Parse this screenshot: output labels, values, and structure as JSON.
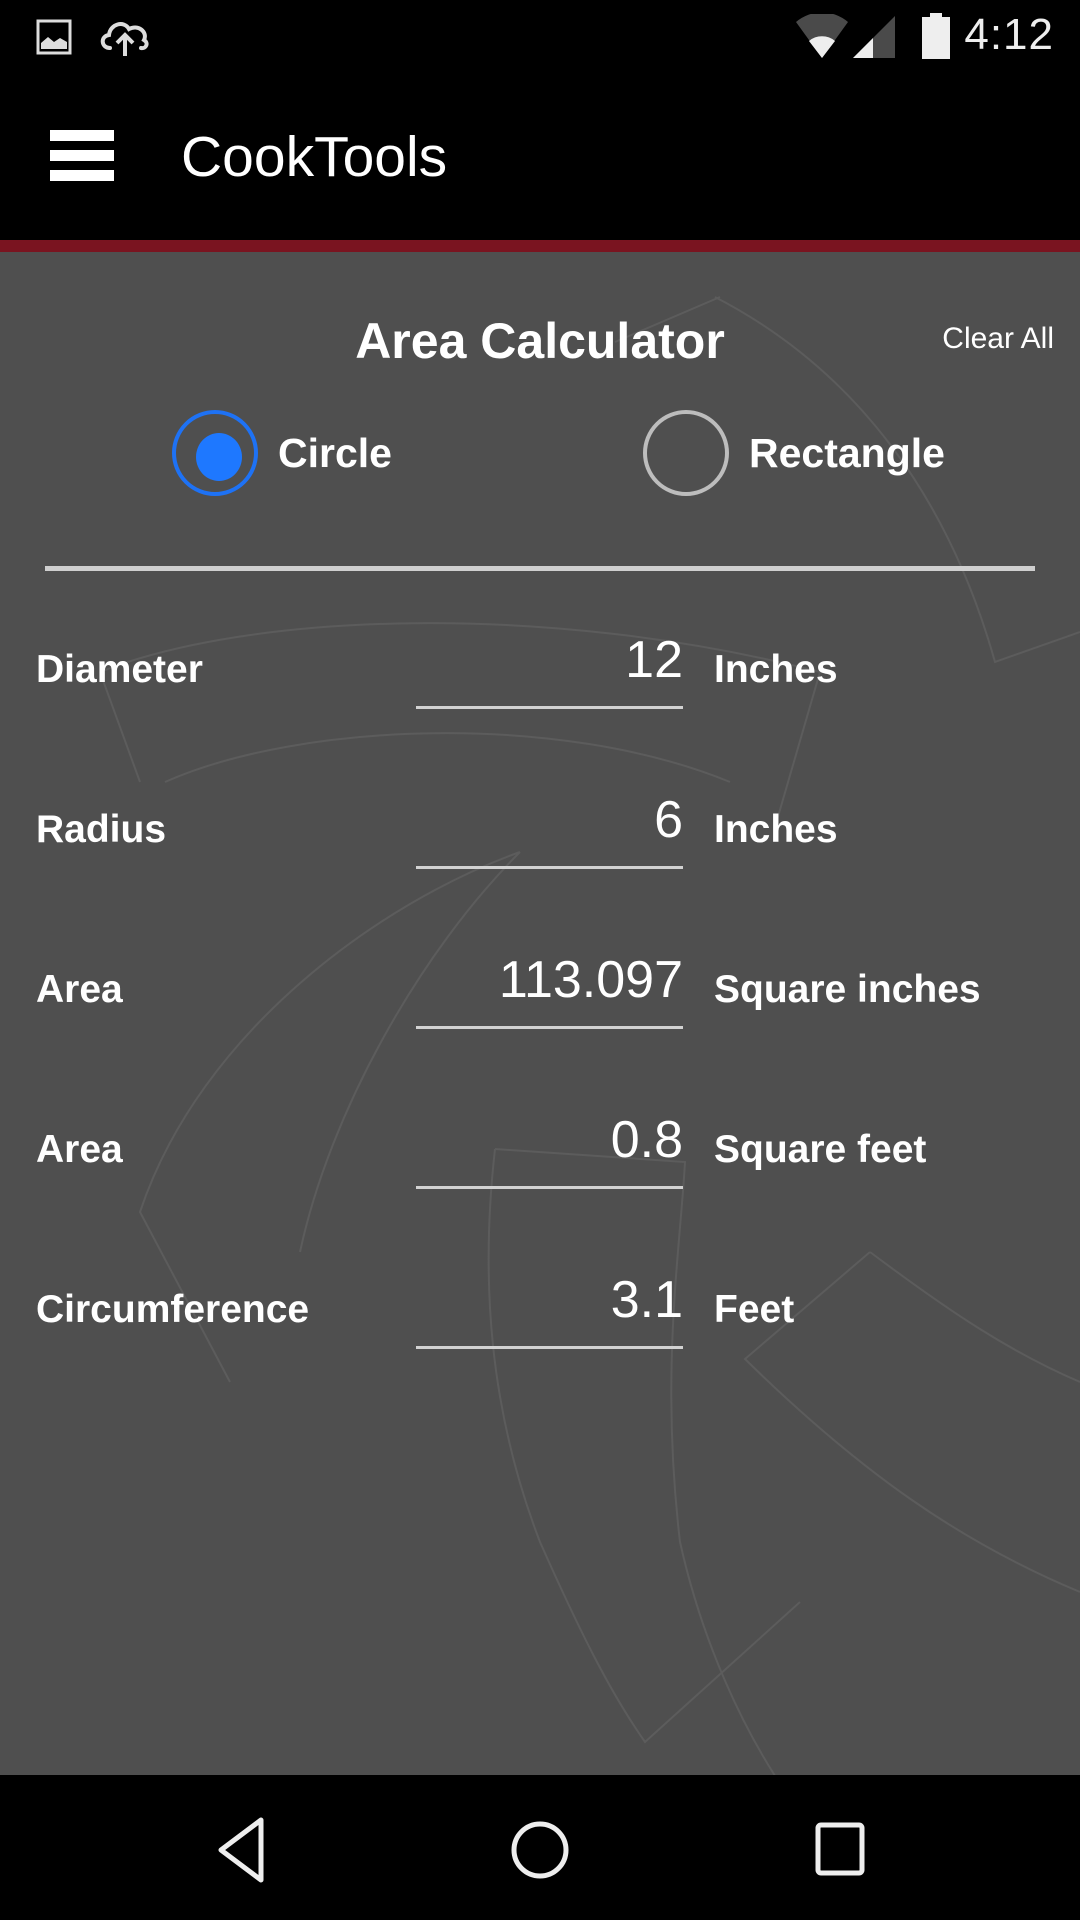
{
  "status_bar": {
    "time": "4:12",
    "left_icons": [
      "image-notification-icon",
      "cloud-upload-icon"
    ],
    "right_icons": [
      "wifi-icon",
      "cell-signal-icon",
      "battery-icon"
    ]
  },
  "app_bar": {
    "title": "CookTools",
    "menu_icon": "hamburger-menu-icon"
  },
  "colors": {
    "accent_strip": "#7a1420",
    "radio_selected": "#1e78ff",
    "background": "#4f4f4f"
  },
  "calculator": {
    "title": "Area Calculator",
    "clear_all_label": "Clear All",
    "shapes": [
      {
        "label": "Circle",
        "selected": true
      },
      {
        "label": "Rectangle",
        "selected": false
      }
    ],
    "rows": [
      {
        "label": "Diameter",
        "value": "12",
        "unit": "Inches"
      },
      {
        "label": "Radius",
        "value": "6",
        "unit": "Inches"
      },
      {
        "label": "Area",
        "value": "113.097",
        "unit": "Square inches"
      },
      {
        "label": "Area",
        "value": "0.8",
        "unit": "Square feet"
      },
      {
        "label": "Circumference",
        "value": "3.1",
        "unit": "Feet"
      }
    ]
  },
  "nav_bar": {
    "buttons": [
      "back-icon",
      "home-icon",
      "recents-icon"
    ]
  }
}
